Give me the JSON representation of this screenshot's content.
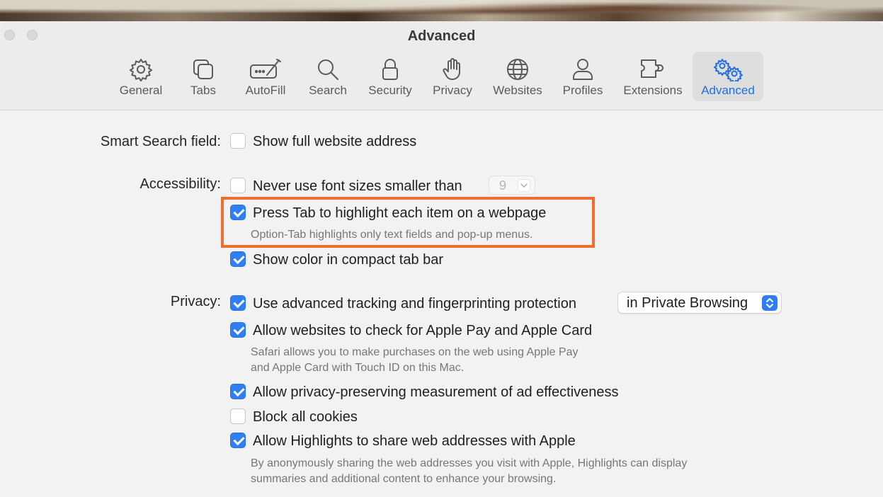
{
  "window": {
    "title": "Advanced"
  },
  "tabs": [
    {
      "label": "General",
      "icon": "gear-icon"
    },
    {
      "label": "Tabs",
      "icon": "tabs-icon"
    },
    {
      "label": "AutoFill",
      "icon": "autofill-pencil-icon"
    },
    {
      "label": "Search",
      "icon": "magnifier-icon"
    },
    {
      "label": "Security",
      "icon": "lock-icon"
    },
    {
      "label": "Privacy",
      "icon": "hand-icon"
    },
    {
      "label": "Websites",
      "icon": "globe-icon"
    },
    {
      "label": "Profiles",
      "icon": "person-icon"
    },
    {
      "label": "Extensions",
      "icon": "puzzle-icon"
    },
    {
      "label": "Advanced",
      "icon": "gears-icon",
      "active": true
    }
  ],
  "settings": {
    "smart_search": {
      "label": "Smart Search field:",
      "show_full_address": {
        "text": "Show full website address",
        "checked": false
      }
    },
    "accessibility": {
      "label": "Accessibility:",
      "never_use_font_sizes": {
        "text": "Never use font sizes smaller than",
        "checked": false,
        "value": "9"
      },
      "press_tab": {
        "text": "Press Tab to highlight each item on a webpage",
        "checked": true,
        "description": "Option-Tab highlights only text fields and pop-up menus."
      },
      "show_color": {
        "text": "Show color in compact tab bar",
        "checked": true
      }
    },
    "privacy": {
      "label": "Privacy:",
      "advanced_tracking": {
        "text": "Use advanced tracking and fingerprinting protection",
        "checked": true,
        "option": "in Private Browsing"
      },
      "apple_pay": {
        "text": "Allow websites to check for Apple Pay and Apple Card",
        "checked": true,
        "description_line1": "Safari allows you to make purchases on the web using Apple Pay",
        "description_line2": "and Apple Card with Touch ID on this Mac."
      },
      "ad_measurement": {
        "text": "Allow privacy-preserving measurement of ad effectiveness",
        "checked": true
      },
      "block_cookies": {
        "text": "Block all cookies",
        "checked": false
      },
      "highlights": {
        "text": "Allow Highlights to share web addresses with Apple",
        "checked": true,
        "description_line1": "By anonymously sharing the web addresses you visit with Apple, Highlights can display",
        "description_line2": "summaries and additional content to enhance your browsing."
      }
    }
  },
  "colors": {
    "accent": "#2f7ef3",
    "annotation": "#ee6f2d"
  }
}
